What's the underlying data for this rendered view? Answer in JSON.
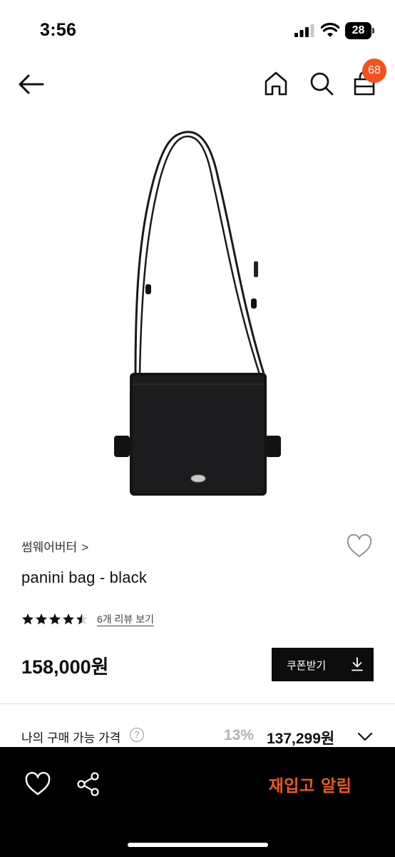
{
  "status_bar": {
    "time": "3:56",
    "battery": "28"
  },
  "nav": {
    "cart_count": "68"
  },
  "product": {
    "brand": "썸웨어버터",
    "brand_chevron": ">",
    "name": "panini bag - black",
    "rating": 4.5,
    "review_link": "6개 리뷰 보기",
    "price": "158,000원",
    "coupon_label": "쿠폰받기",
    "my_price_label": "나의 구매 가능 가격",
    "help_symbol": "?",
    "discount_rate": "13%",
    "my_price": "137,299원"
  },
  "bottom_bar": {
    "restock_label": "재입고 알림"
  },
  "colors": {
    "accent": "#f0561f",
    "badge": "#f4511e",
    "dark": "#0d0d0d"
  },
  "icons": [
    "back-arrow-icon",
    "home-icon",
    "search-icon",
    "cart-icon",
    "heart-icon",
    "star-icon",
    "download-icon",
    "help-icon",
    "chevron-down-icon",
    "share-icon"
  ]
}
